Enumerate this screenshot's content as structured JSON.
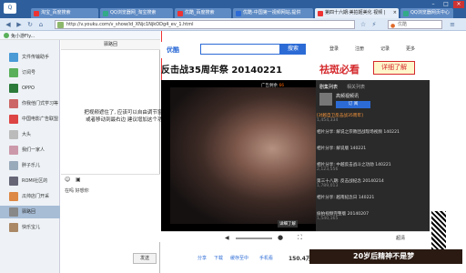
{
  "tabs": [
    {
      "label": "淘宝_百度搜索",
      "active": false,
      "color": "#e33"
    },
    {
      "label": "QQ浏览器网_淘宝搜索",
      "active": false,
      "color": "#3a8"
    },
    {
      "label": "优酷_百度搜索",
      "active": false,
      "color": "#e33"
    },
    {
      "label": "优酷-中国第一视频网站,提供",
      "active": false,
      "color": "#2c6bd6"
    },
    {
      "label": "第四十六期:美拍姬美化 视频 |",
      "active": true,
      "color": "#e33"
    },
    {
      "label": "QQ浏览器网页中心",
      "active": false,
      "color": "#3a8"
    }
  ],
  "address": {
    "url": "http://v.youku.com/v_show/id_XNjc1NjkODg4_ev_1.html",
    "search_placeholder": "优酷"
  },
  "qq": {
    "header_name": "兔小游Fly...",
    "chat_title": "驿路回",
    "tools": "字体",
    "contacts": [
      {
        "label": "文件传输助手",
        "color": "#4a9ad6"
      },
      {
        "label": "订阅号",
        "color": "#5ab05a"
      },
      {
        "label": "OPPO",
        "color": "#2b7a3a"
      },
      {
        "label": "你我他门式学习等",
        "color": "#c66"
      },
      {
        "label": "中国电影广告联盟",
        "color": "#d44"
      },
      {
        "label": "大头",
        "color": "#bbb"
      },
      {
        "label": "我们一家人",
        "color": "#c9a"
      },
      {
        "label": "胖子乐儿",
        "color": "#9ab"
      },
      {
        "label": "ROMI社区的",
        "color": "#667"
      },
      {
        "label": "瓜帅店门开采",
        "color": "#d84"
      },
      {
        "label": "驿路回",
        "color": "#888",
        "selected": true
      },
      {
        "label": "快乐宝儿",
        "color": "#a86"
      }
    ],
    "compose_text": "在吗 好想你",
    "send_label": "发送"
  },
  "site": {
    "logo": "优酷",
    "search_button": "搜索",
    "nav": [
      "登录",
      "注册",
      "记录",
      "更多"
    ],
    "title": "反击战35周年祭 20140221",
    "ad_text": "祛斑必看",
    "ad_button": "详细了解"
  },
  "annotation": "把视频遮住了, 应该可以自由调节窗口, 或者移动到最右边 建议增加这个功能",
  "related": {
    "tabs": [
      "剧集列表",
      "相关列表"
    ],
    "channel": "高频视频讯",
    "channel_button": "订 阅",
    "items": [
      {
        "title": "[对越自卫反击战35周年]",
        "count": "1,454,334"
      },
      {
        "title": "相片分享: 解说之宗教团战现场视频 140221",
        "count": ""
      },
      {
        "title": "相片分享: 解说版 140221",
        "count": ""
      },
      {
        "title": "相片分享: 中越反击战斗之功勋 140221",
        "count": "2,123,556"
      },
      {
        "title": "第三十八期: 反击战纪念 20140214",
        "count": "1,789,013"
      },
      {
        "title": "相片分享: 越南纪念日 140221",
        "count": ""
      },
      {
        "title": "偷拍视频完整版 20140207",
        "count": "1,540,165"
      }
    ]
  },
  "player": {
    "ad_label": "广告剩余",
    "ad_seconds": "66",
    "skip_label": "详细了解",
    "time_label": "",
    "fullscreen_label": "超清",
    "quality_label": "超清"
  },
  "footer": {
    "labels": [
      "分享",
      "下载",
      "缓存至中",
      "手机看"
    ],
    "play_count": "150.4万",
    "banner_text": "20岁后精神不是梦"
  },
  "colors": {
    "accent": "#2c6bd6",
    "ad_red": "#d4292c",
    "browser_bar": "#2e5f9c"
  }
}
